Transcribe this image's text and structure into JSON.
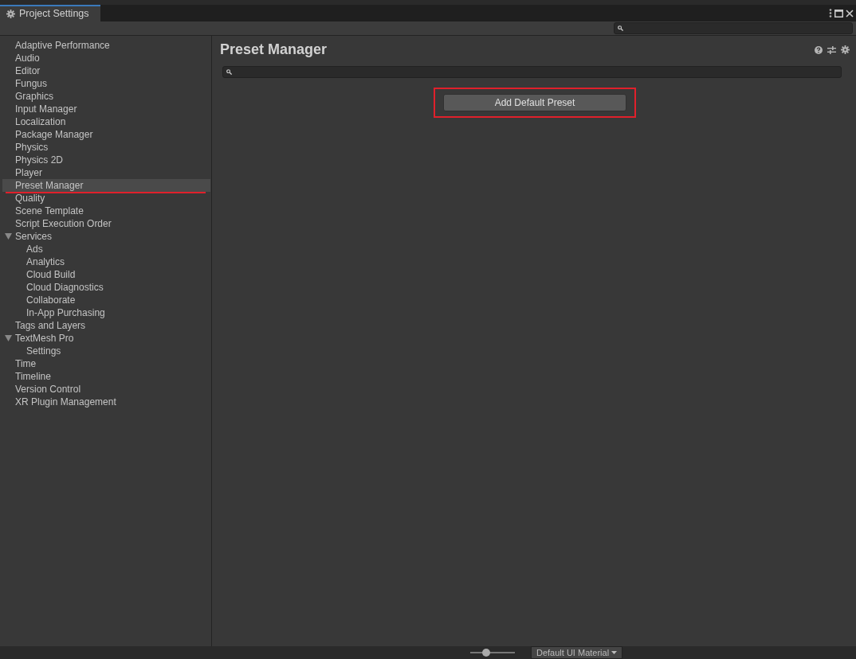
{
  "window": {
    "title": "Project Settings"
  },
  "sidebar": {
    "items": [
      {
        "label": "Adaptive Performance",
        "selected": false
      },
      {
        "label": "Audio",
        "selected": false
      },
      {
        "label": "Editor",
        "selected": false
      },
      {
        "label": "Fungus",
        "selected": false
      },
      {
        "label": "Graphics",
        "selected": false
      },
      {
        "label": "Input Manager",
        "selected": false
      },
      {
        "label": "Localization",
        "selected": false
      },
      {
        "label": "Package Manager",
        "selected": false
      },
      {
        "label": "Physics",
        "selected": false
      },
      {
        "label": "Physics 2D",
        "selected": false
      },
      {
        "label": "Player",
        "selected": false
      },
      {
        "label": "Preset Manager",
        "selected": true,
        "underlined": true
      },
      {
        "label": "Quality",
        "selected": false
      },
      {
        "label": "Scene Template",
        "selected": false
      },
      {
        "label": "Script Execution Order",
        "selected": false
      },
      {
        "label": "Services",
        "selected": false,
        "expanded": true,
        "children": [
          {
            "label": "Ads",
            "selected": false
          },
          {
            "label": "Analytics",
            "selected": false
          },
          {
            "label": "Cloud Build",
            "selected": false
          },
          {
            "label": "Cloud Diagnostics",
            "selected": false
          },
          {
            "label": "Collaborate",
            "selected": false
          },
          {
            "label": "In-App Purchasing",
            "selected": false
          }
        ]
      },
      {
        "label": "Tags and Layers",
        "selected": false
      },
      {
        "label": "TextMesh Pro",
        "selected": false,
        "expanded": true,
        "children": [
          {
            "label": "Settings",
            "selected": false
          }
        ]
      },
      {
        "label": "Time",
        "selected": false
      },
      {
        "label": "Timeline",
        "selected": false
      },
      {
        "label": "Version Control",
        "selected": false
      },
      {
        "label": "XR Plugin Management",
        "selected": false
      }
    ]
  },
  "content": {
    "title": "Preset Manager",
    "button": {
      "label": "Add Default Preset",
      "highlighted": true
    }
  },
  "background_bottom": {
    "material": "Default UI Material",
    "slider": {
      "level": 0.35
    }
  }
}
